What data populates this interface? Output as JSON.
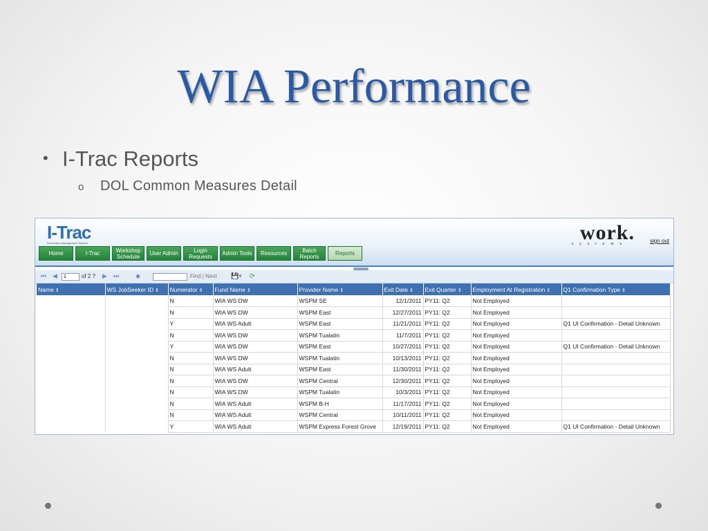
{
  "slide": {
    "title": "WIA Performance",
    "bullet1": "I-Trac Reports",
    "bullet1_marker": "•",
    "bullet2": "DOL Common Measures Detail",
    "bullet2_marker": "o"
  },
  "app": {
    "logo": "I-Trac",
    "logo_subtitle": "Information Management System",
    "brand": "work.",
    "brand_sub": "systems",
    "signout": "sign out",
    "nav": [
      {
        "label": "Home"
      },
      {
        "label": "I-Trac"
      },
      {
        "label": "Workshop Schedule"
      },
      {
        "label": "User Admin"
      },
      {
        "label": "Login Requests"
      },
      {
        "label": "Admin Tools"
      },
      {
        "label": "Resources"
      },
      {
        "label": "Batch Reports"
      },
      {
        "label": "Reports",
        "active": true
      }
    ],
    "toolbar": {
      "page": "1",
      "of_pages": "of 2 ?",
      "find_next": "Find | Next"
    },
    "table": {
      "columns": [
        "Name",
        "WS JobSeeker ID",
        "Numerator",
        "Fund Name",
        "Provider Name",
        "Exit Date",
        "Exit Quarter",
        "Employment At Registration",
        "Q1 Confirmation Type"
      ],
      "rows": [
        [
          "",
          "",
          "N",
          "WIA WS DW",
          "WSPM SE",
          "12/1/2011",
          "PY11: Q2",
          "Not Employed",
          ""
        ],
        [
          "",
          "",
          "N",
          "WIA WS DW",
          "WSPM East",
          "12/27/2011",
          "PY11: Q2",
          "Not Employed",
          ""
        ],
        [
          "",
          "",
          "Y",
          "WIA WS Adult",
          "WSPM East",
          "11/21/2011",
          "PY11: Q2",
          "Not Employed",
          "Q1 UI Confirmation - Detail Unknown"
        ],
        [
          "",
          "",
          "N",
          "WIA WS DW",
          "WSPM Tualatin",
          "11/7/2011",
          "PY11: Q2",
          "Not Employed",
          ""
        ],
        [
          "",
          "",
          "Y",
          "WIA WS DW",
          "WSPM East",
          "10/27/2011",
          "PY11: Q2",
          "Not Employed",
          "Q1 UI Confirmation - Detail Unknown"
        ],
        [
          "",
          "",
          "N",
          "WIA WS DW",
          "WSPM Tualatin",
          "10/13/2011",
          "PY11: Q2",
          "Not Employed",
          ""
        ],
        [
          "",
          "",
          "N",
          "WIA WS Adult",
          "WSPM East",
          "11/30/2011",
          "PY11: Q2",
          "Not Employed",
          ""
        ],
        [
          "",
          "",
          "N",
          "WIA WS DW",
          "WSPM Central",
          "12/30/2011",
          "PY11: Q2",
          "Not Employed",
          ""
        ],
        [
          "",
          "",
          "N",
          "WIA WS DW",
          "WSPM Tualatin",
          "10/3/2011",
          "PY11: Q2",
          "Not Employed",
          ""
        ],
        [
          "",
          "",
          "N",
          "WIA WS Adult",
          "WSPM B-H",
          "11/17/2011",
          "PY11: Q2",
          "Not Employed",
          ""
        ],
        [
          "",
          "",
          "N",
          "WIA WS Adult",
          "WSPM Central",
          "10/11/2011",
          "PY11: Q2",
          "Not Employed",
          ""
        ],
        [
          "",
          "",
          "Y",
          "WIA WS Adult",
          "WSPM Express Forest Grove",
          "12/19/2011",
          "PY11: Q2",
          "Not Employed",
          "Q1 UI Confirmation - Detail Unknown"
        ]
      ]
    }
  },
  "colors": {
    "title": "#2a5aa3",
    "nav_green": "#23843a",
    "table_header": "#3f71b0"
  }
}
